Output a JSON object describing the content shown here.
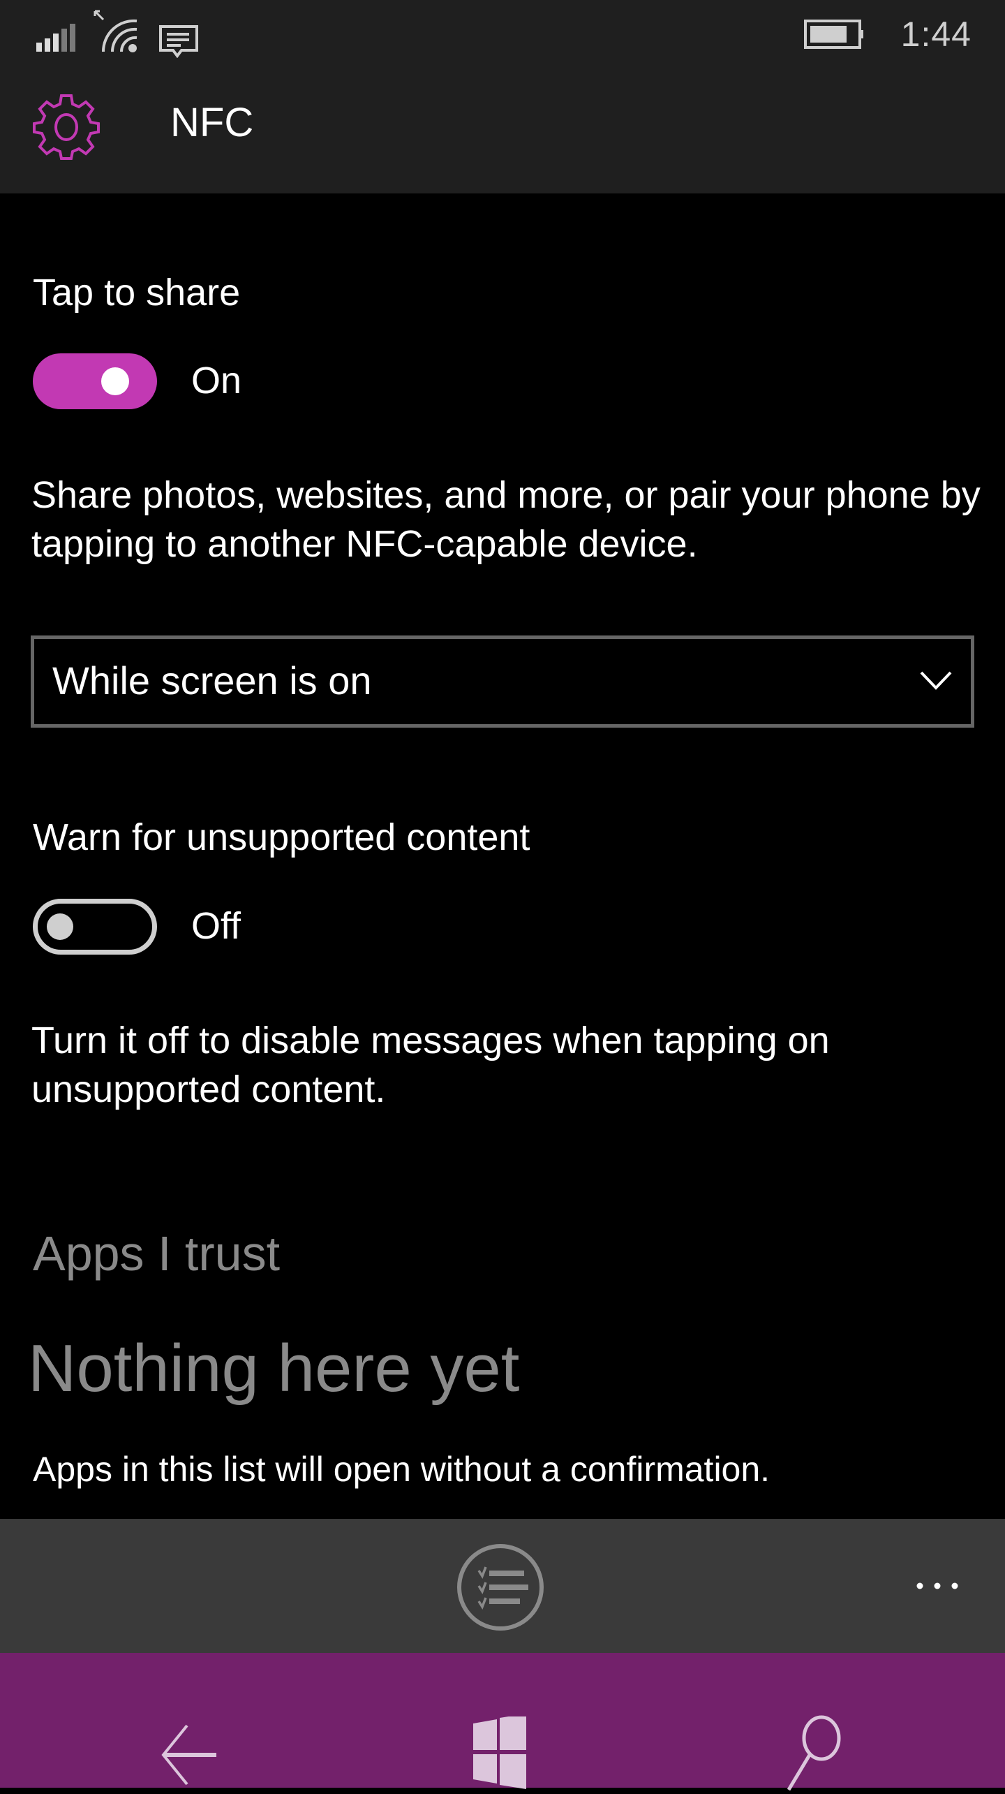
{
  "status_bar": {
    "time": "1:44",
    "icons": [
      "signal-strength-icon",
      "wifi-icon",
      "message-icon",
      "battery-icon"
    ]
  },
  "header": {
    "icon": "gear-icon",
    "title": "NFC"
  },
  "accent_color": "#c239b3",
  "tap_to_share": {
    "label": "Tap to share",
    "state": "On",
    "enabled": true,
    "description": "Share photos, websites, and more, or pair your phone by tapping to another NFC-capable device."
  },
  "share_mode_dropdown": {
    "selected": "While screen is on"
  },
  "warn_unsupported": {
    "label": "Warn for unsupported content",
    "state": "Off",
    "enabled": false,
    "description": "Turn it off to disable messages when tapping on unsupported content."
  },
  "apps_i_trust": {
    "heading": "Apps I trust",
    "empty_message": "Nothing here yet",
    "note": "Apps in this list will open without a confirmation."
  },
  "command_bar": {
    "primary_icon": "checklist-icon",
    "more_icon": "more-ellipsis-icon"
  },
  "nav_bar": {
    "color": "#73216b",
    "buttons": [
      "back-arrow-icon",
      "windows-start-icon",
      "search-icon"
    ]
  }
}
